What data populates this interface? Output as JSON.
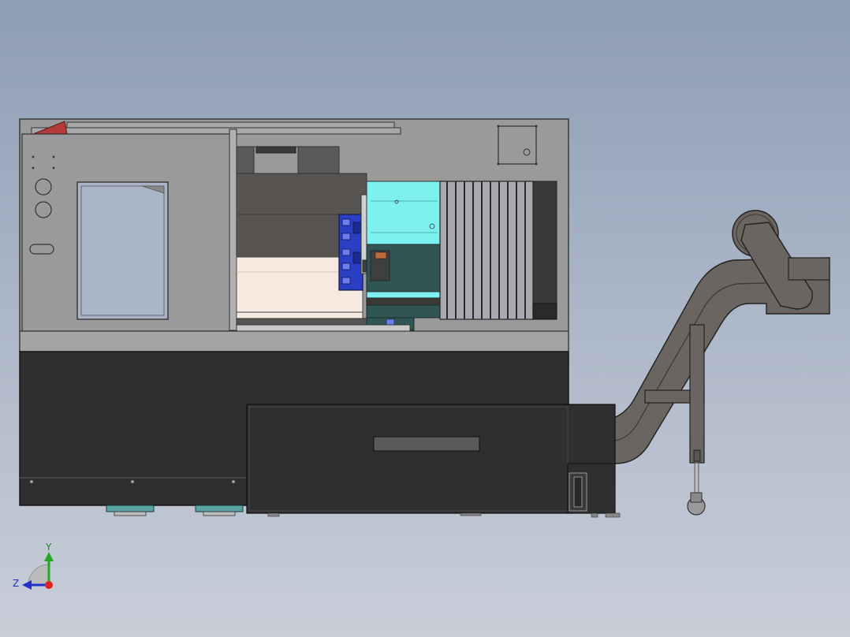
{
  "viewport": {
    "background_top": "#8d9db4",
    "background_bottom": "#c9ced9"
  },
  "machine": {
    "type": "CNC lathe with chip conveyor",
    "view": "front view",
    "colors": {
      "housing": "#9a9a9a",
      "base": "#2f2f2f",
      "trim": "#c8c8c8",
      "door_red": "#b43a3a",
      "tool_turret_blue": "#2b3fc4",
      "interior_cyan": "#7ff0f0",
      "interior_teal": "#2f5555",
      "conveyor": "#6a6560",
      "feet_teal": "#5aa3a3"
    }
  },
  "triad": {
    "y_label": "Y",
    "z_label": "Z",
    "colors": {
      "y": "#22aa22",
      "z": "#2233cc",
      "x": "#dd2222"
    }
  }
}
